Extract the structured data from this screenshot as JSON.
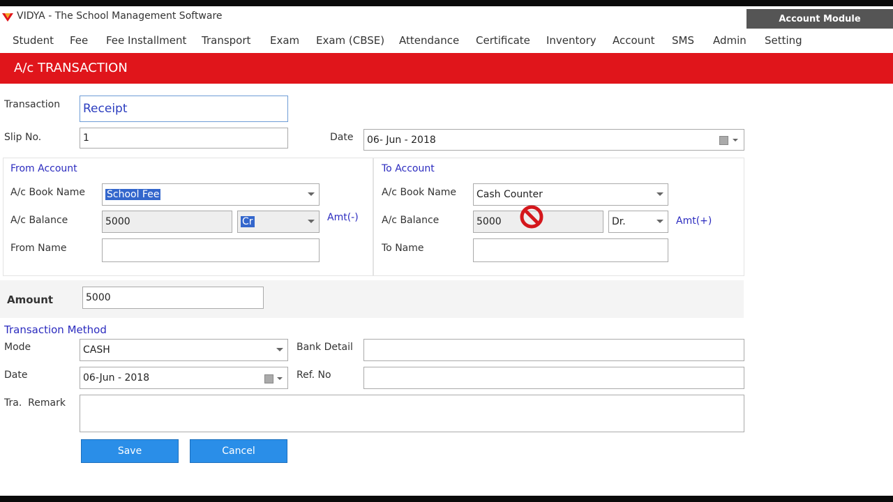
{
  "app": {
    "title": "VIDYA - The School Management Software",
    "module_button": "Account Module"
  },
  "menu": [
    "Student",
    "Fee",
    "Fee Installment",
    "Transport",
    "Exam",
    "Exam (CBSE)",
    "Attendance",
    "Certificate",
    "Inventory",
    "Account",
    "SMS",
    "Admin",
    "Setting"
  ],
  "page": {
    "title": "A/c TRANSACTION"
  },
  "form": {
    "transaction_label": "Transaction",
    "transaction_value": "Receipt",
    "slip_label": "Slip No.",
    "slip_value": "1",
    "date_label": "Date",
    "date_value": "06- Jun - 2018"
  },
  "from_account": {
    "heading": "From Account",
    "book_label": "A/c Book Name",
    "book_value": "School Fee",
    "balance_label": "A/c Balance",
    "balance_value": "5000",
    "balance_type": "Cr",
    "amt_sign": "Amt(-)",
    "name_label": "From Name",
    "name_value": ""
  },
  "to_account": {
    "heading": "To Account",
    "book_label": "A/c Book Name",
    "book_value": "Cash Counter",
    "balance_label": "A/c Balance",
    "balance_value": "5000",
    "balance_type": "Dr.",
    "amt_sign": "Amt(+)",
    "name_label": "To Name",
    "name_value": ""
  },
  "amount": {
    "label": "Amount",
    "value": "5000"
  },
  "method": {
    "heading": "Transaction Method",
    "mode_label": "Mode",
    "mode_value": "CASH",
    "bank_label": "Bank Detail",
    "bank_value": "",
    "date_label": "Date",
    "date_value": "06-Jun - 2018",
    "ref_label": "Ref. No",
    "ref_value": "",
    "remark_label": "Tra.  Remark",
    "remark_value": ""
  },
  "buttons": {
    "save": "Save",
    "cancel": "Cancel"
  },
  "colors": {
    "header_red": "#e0151b",
    "button_blue": "#2a8ee8",
    "label_blue": "#2b2bbf"
  }
}
